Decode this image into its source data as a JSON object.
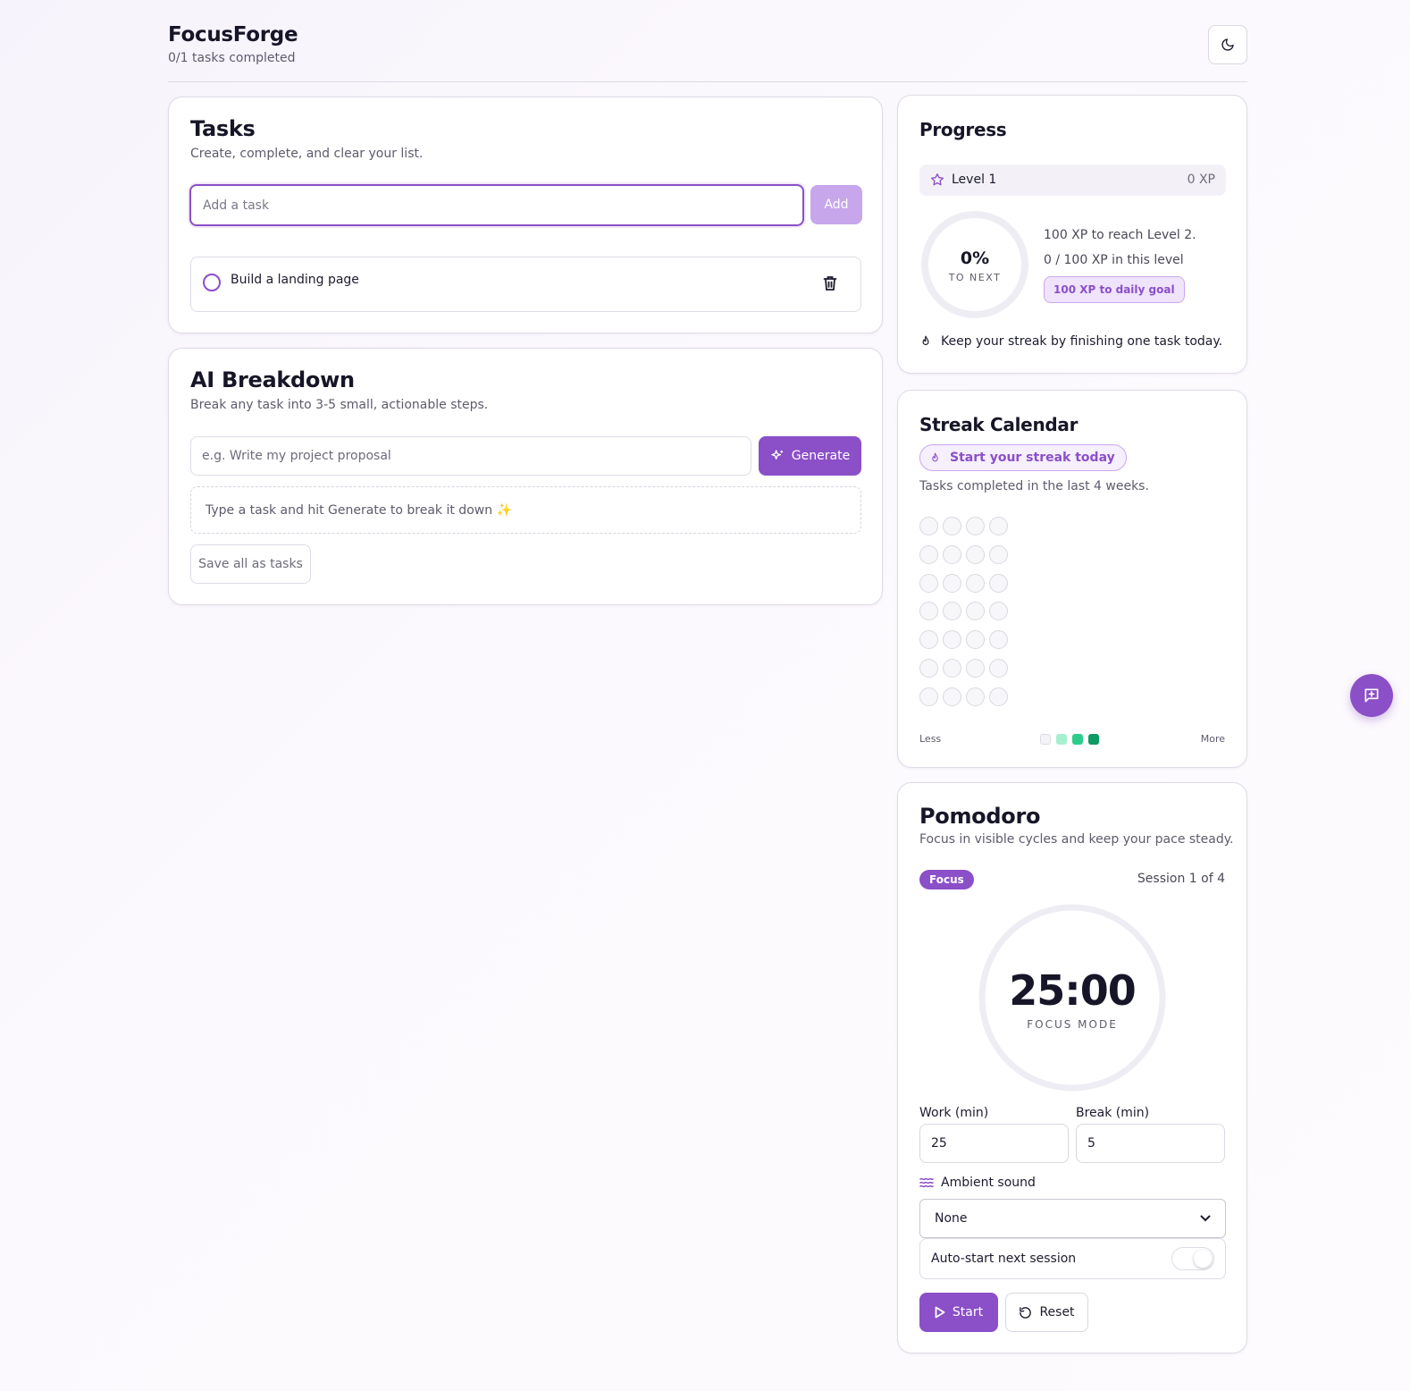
{
  "header": {
    "title": "FocusForge",
    "subtitle": "0/1 tasks completed",
    "theme_icon": "moon-icon"
  },
  "tasks": {
    "title": "Tasks",
    "subtitle": "Create, complete, and clear your list.",
    "input_placeholder": "Add a task",
    "add_label": "Add",
    "items": [
      {
        "text": "Build a landing page",
        "done": false
      }
    ]
  },
  "ai": {
    "title": "AI Breakdown",
    "subtitle": "Break any task into 3-5 small, actionable steps.",
    "input_placeholder": "e.g. Write my project proposal",
    "generate_label": "Generate",
    "hint": "Type a task and hit Generate to break it down ✨",
    "save_label": "Save all as tasks"
  },
  "progress": {
    "title": "Progress",
    "level": "Level 1",
    "xp": "0 XP",
    "ring_percent": "0%",
    "ring_label": "TO NEXT",
    "ring_fraction": 0,
    "line1": "100 XP to reach Level 2.",
    "line2": "0 / 100 XP in this level",
    "goal_pill": "100 XP to daily goal",
    "streak_hint": "Keep your streak by finishing one task today."
  },
  "streak": {
    "title": "Streak Calendar",
    "pill": "Start your streak today",
    "subtitle": "Tasks completed in the last 4 weeks.",
    "legend_less": "Less",
    "legend_more": "More",
    "legend_colors": [
      "#f3f2f6",
      "#a7f0cf",
      "#2ecc8a",
      "#0e9a64"
    ]
  },
  "pomodoro": {
    "title": "Pomodoro",
    "subtitle": "Focus in visible cycles and keep your pace steady.",
    "mode": "Focus",
    "session": "Session 1 of 4",
    "time": "25:00",
    "time_label": "FOCUS MODE",
    "work_label": "Work (min)",
    "work_value": "25",
    "break_label": "Break (min)",
    "break_value": "5",
    "ambient_label": "Ambient sound",
    "ambient_value": "None",
    "auto_label": "Auto-start next session",
    "start_label": "Start",
    "reset_label": "Reset"
  },
  "colors": {
    "accent": "#8b4fc8",
    "accent_light": "#c7a6ec"
  },
  "fab_icon": "chat-plus-icon"
}
